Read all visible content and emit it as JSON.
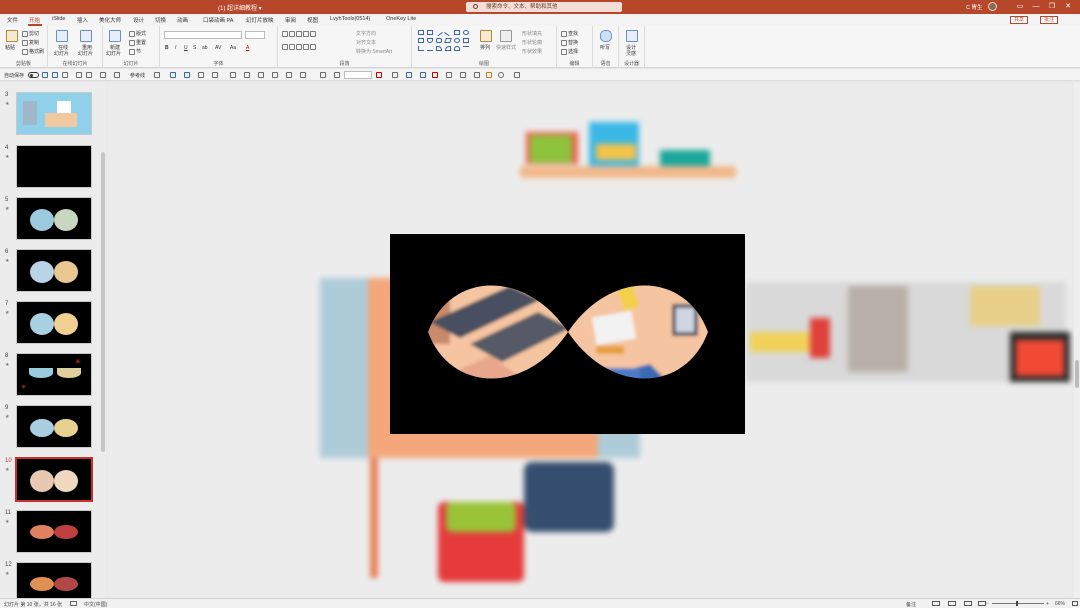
{
  "window": {
    "title": "(1) 超详细教程 ▾",
    "search_placeholder": "搜索命令、文本、帮助和其他",
    "user": "C 胃生",
    "controls": [
      "▭",
      "—",
      "❐",
      "✕"
    ]
  },
  "tabs": [
    "文件",
    "开始",
    "iSlide",
    "插入",
    "美化大师",
    "设计",
    "切换",
    "动画",
    "口袋动画 PA",
    "幻灯片放映",
    "审阅",
    "视图",
    "LvyhTools(0514)",
    "OneKey Lite"
  ],
  "active_tab": "开始",
  "share": {
    "share_label": "共享",
    "comment_label": "批注"
  },
  "ribbon": {
    "clipboard": {
      "paste": "粘贴",
      "cut": "剪切",
      "copy": "复制",
      "format_painter": "格式刷",
      "label": "剪贴板"
    },
    "new_slide_group": {
      "present_online": "在线",
      "present_online2": "幻灯片",
      "redo_slide": "重用",
      "redo_slide2": "幻灯片",
      "label": "在线幻灯片"
    },
    "slides": {
      "new_slide": "新建",
      "new_slide2": "幻灯片",
      "layout": "版式",
      "reset": "重置",
      "section": "节",
      "label": "幻灯片"
    },
    "font": {
      "label": "字体",
      "bold": "B",
      "italic": "I",
      "underline": "U",
      "strike": "S",
      "shadow": "ab",
      "spacing": "AV",
      "case": "Aa",
      "color": "A"
    },
    "paragraph": {
      "text_direction": "文字方向",
      "align_text": "对齐文本",
      "smartart": "转换为 SmartArt",
      "label": "段落"
    },
    "drawing": {
      "arrange": "排列",
      "quick_styles": "快速样式",
      "fill": "形状填充",
      "outline": "形状轮廓",
      "effects": "形状效果",
      "label": "绘图"
    },
    "editing": {
      "find": "查找",
      "replace": "替换",
      "select": "选择",
      "label": "编辑"
    },
    "voice": {
      "dictate": "听写",
      "label": "语音"
    },
    "designer": {
      "design_ideas": "设计",
      "design_ideas2": "灵感",
      "label": "设计器"
    }
  },
  "qat": {
    "autosave": "自动保存",
    "ref_lines": "参考线"
  },
  "slides": [
    {
      "num": "3",
      "star": "★",
      "kind": "scene"
    },
    {
      "num": "4",
      "star": "★",
      "kind": "black"
    },
    {
      "num": "5",
      "star": "★",
      "kind": "lens"
    },
    {
      "num": "6",
      "star": "★",
      "kind": "lens"
    },
    {
      "num": "7",
      "star": "★",
      "kind": "lens"
    },
    {
      "num": "8",
      "star": "★",
      "kind": "eyes"
    },
    {
      "num": "9",
      "star": "★",
      "kind": "lens"
    },
    {
      "num": "10",
      "star": "★",
      "kind": "lens-active"
    },
    {
      "num": "11",
      "star": "★",
      "kind": "lens-red"
    },
    {
      "num": "12",
      "star": "★",
      "kind": "lens-red"
    }
  ],
  "status": {
    "slide_info": "幻灯片 第 10 张，共 16 张",
    "language": "中文(中国)",
    "notes": "备注",
    "zoom": "66%"
  },
  "colors": {
    "accent": "#b7472a",
    "active_slide_border": "#c8312a"
  }
}
